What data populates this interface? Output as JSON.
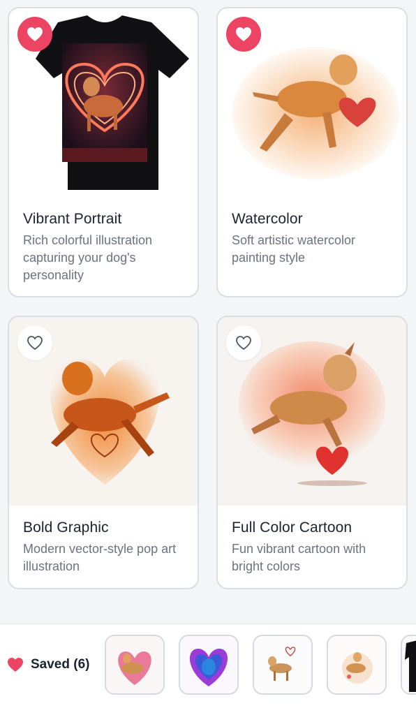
{
  "cards": [
    {
      "title": "Vibrant Portrait",
      "desc": "Rich colorful illustration capturing your dog's personality",
      "favorited": true
    },
    {
      "title": "Watercolor",
      "desc": "Soft artistic watercolor painting style",
      "favorited": true
    },
    {
      "title": "Bold Graphic",
      "desc": "Modern vector-style pop art illustration",
      "favorited": false
    },
    {
      "title": "Full Color Cartoon",
      "desc": "Fun vibrant cartoon with bright colors",
      "favorited": false
    }
  ],
  "saved": {
    "label": "Saved (6)",
    "icon": "heart-icon"
  },
  "colors": {
    "accent": "#ee4463",
    "border": "#d9dde4",
    "muted_text": "#6b7280"
  }
}
